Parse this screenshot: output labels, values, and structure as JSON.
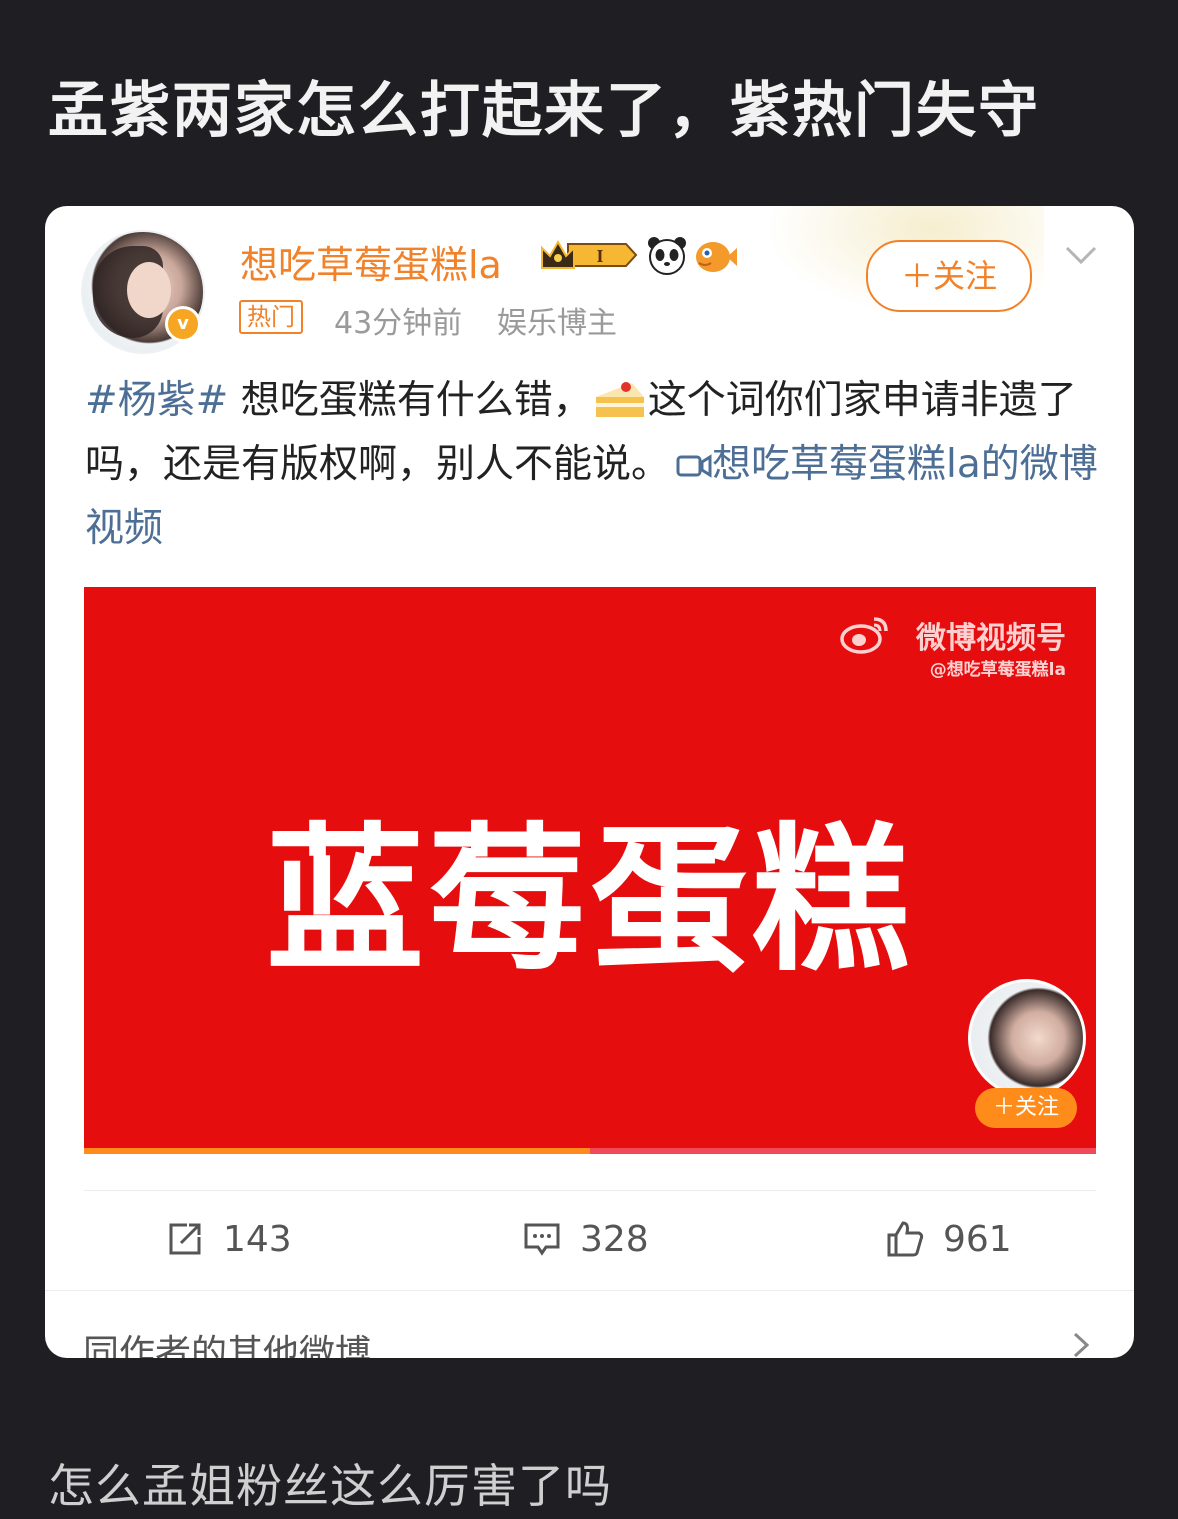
{
  "post": {
    "title": "孟紫两家怎么打起来了，紫热门失守",
    "comment": "怎么孟姐粉丝这么厉害了吗"
  },
  "card": {
    "username": "想吃草莓蛋糕la",
    "verified_mark": "v",
    "hot_tag": "热门",
    "time_ago": "43分钟前",
    "user_tag": "娱乐博主",
    "follow_label": "＋关注",
    "badge_level": "I",
    "text": {
      "hashtag": "#杨紫#",
      "part1": " 想吃蛋糕有什么错，",
      "part2": "这个词你们家申请非遗了吗，还是有版权啊，别人不能说。",
      "video_link": "想吃草莓蛋糕la的微博视频"
    },
    "video": {
      "big_text": "蓝莓蛋糕",
      "brand": "微博视频号",
      "handle": "@想吃草莓蛋糕la",
      "follow_label": "＋关注",
      "progress": 0.5
    },
    "actions": {
      "repost_count": "143",
      "comment_count": "328",
      "like_count": "961"
    },
    "more_section_label": "同作者的其他微博"
  },
  "colors": {
    "background": "#1f1f23",
    "accent_orange": "#f1822a",
    "link_blue": "#4e6f95",
    "video_red": "#e60d0f"
  },
  "icons": [
    "crown-badge-icon",
    "panda-icon",
    "fish-icon",
    "chevron-down-icon",
    "cake-icon",
    "video-icon",
    "weibo-logo-icon",
    "repost-icon",
    "comment-icon",
    "like-icon",
    "chevron-right-icon"
  ]
}
